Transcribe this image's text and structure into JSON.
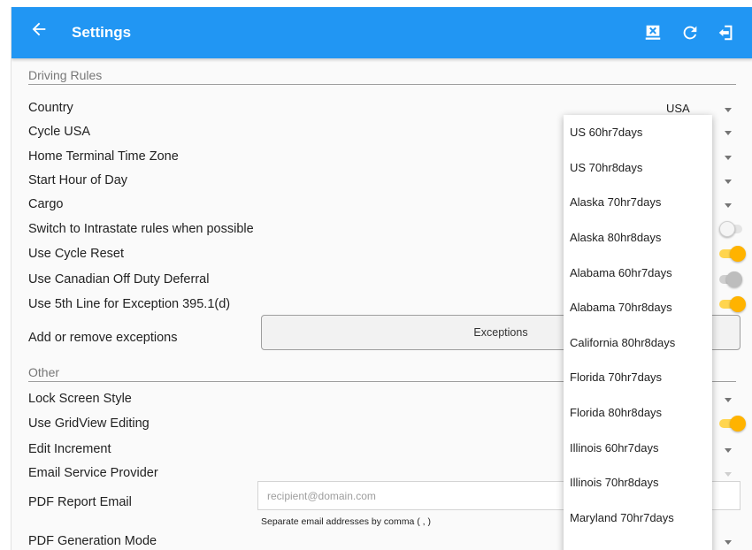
{
  "appbar": {
    "title": "Settings",
    "icons": [
      "back-arrow-icon",
      "report-icon",
      "refresh-icon",
      "logout-icon"
    ]
  },
  "sections": {
    "driving_rules": "Driving Rules",
    "other": "Other"
  },
  "rows": {
    "country": {
      "label": "Country",
      "value": "USA"
    },
    "cycle": {
      "label": "Cycle USA"
    },
    "home_terminal_tz": {
      "label": "Home Terminal Time Zone"
    },
    "start_hour": {
      "label": "Start Hour of Day"
    },
    "cargo": {
      "label": "Cargo"
    },
    "intrastate": {
      "label": "Switch to Intrastate rules when possible",
      "on": false
    },
    "cycle_reset": {
      "label": "Use Cycle Reset",
      "on": true
    },
    "canadian_deferral": {
      "label": "Use Canadian Off Duty Deferral",
      "on": false
    },
    "fifth_line": {
      "label": "Use 5th Line for Exception 395.1(d)",
      "on": true
    },
    "exceptions": {
      "label": "Add or remove exceptions",
      "button": "Exceptions"
    },
    "lock_screen": {
      "label": "Lock Screen Style"
    },
    "gridview": {
      "label": "Use GridView Editing",
      "on": true
    },
    "edit_increment": {
      "label": "Edit Increment"
    },
    "email_provider": {
      "label": "Email Service Provider"
    },
    "pdf_email": {
      "label": "PDF Report Email",
      "placeholder": "recipient@domain.com",
      "hint": "Separate email addresses by comma ( , )"
    },
    "pdf_generation": {
      "label": "PDF Generation Mode"
    }
  },
  "dropdown": {
    "options": [
      "US 60hr7days",
      "US 70hr8days",
      "Alaska 70hr7days",
      "Alaska 80hr8days",
      "Alabama 60hr7days",
      "Alabama 70hr8days",
      "California 80hr8days",
      "Florida 70hr7days",
      "Florida 80hr8days",
      "Illinois 60hr7days",
      "Illinois 70hr8days",
      "Maryland 70hr7days"
    ]
  },
  "colors": {
    "appbar": "#2196f3",
    "toggle_on": "#ffb300"
  }
}
